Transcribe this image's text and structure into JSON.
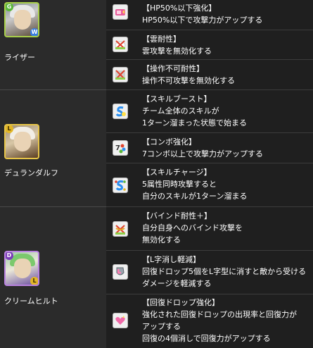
{
  "characters": [
    {
      "name": "ライザー",
      "frame_color": "#a9d04a",
      "main_attr": "G",
      "sub_attr": "W",
      "skills": [
        {
          "icon": "hp-weak-boost-icon",
          "name": "【HP50%以下強化】",
          "lines": [
            "HP50%以下で攻撃力がアップする"
          ]
        },
        {
          "icon": "cloud-resist-icon",
          "name": "【雲耐性】",
          "lines": [
            "雲攻撃を無効化する"
          ]
        },
        {
          "icon": "unmovable-resist-icon",
          "name": "【操作不可耐性】",
          "lines": [
            "操作不可攻撃を無効化する"
          ]
        }
      ]
    },
    {
      "name": "デュランダルフ",
      "frame_color": "#e7c548",
      "main_attr": "L",
      "sub_attr": "",
      "skills": [
        {
          "icon": "skill-boost-icon",
          "name": "【スキルブースト】",
          "lines": [
            "チーム全体のスキルが",
            "1ターン溜まった状態で始まる"
          ]
        },
        {
          "icon": "combo-boost-icon",
          "name": "【コンボ強化】",
          "lines": [
            "7コンボ以上で攻撃力がアップする"
          ]
        },
        {
          "icon": "skill-charge-icon",
          "name": "【スキルチャージ】",
          "lines": [
            "5属性同時攻撃すると",
            "自分のスキルが1ターン溜まる"
          ]
        }
      ]
    },
    {
      "name": "クリームヒルト",
      "frame_color": "#b982e0",
      "main_attr": "D",
      "sub_attr": "L",
      "skills": [
        {
          "icon": "bind-resist-plus-icon",
          "name": "【バインド耐性＋】",
          "lines": [
            "自分自身へのバインド攻撃を",
            "無効化する"
          ]
        },
        {
          "icon": "l-shape-reduce-icon",
          "name": "【L字消し軽減】",
          "lines": [
            "回復ドロップ5個をL字型に消すと敵から受ける",
            "ダメージを軽減する"
          ]
        },
        {
          "icon": "heal-orb-boost-icon",
          "name": "【回復ドロップ強化】",
          "lines": [
            "強化された回復ドロップの出現率と回復力が",
            "アップする",
            "回復の4個消しで回復力がアップする"
          ]
        }
      ]
    }
  ]
}
